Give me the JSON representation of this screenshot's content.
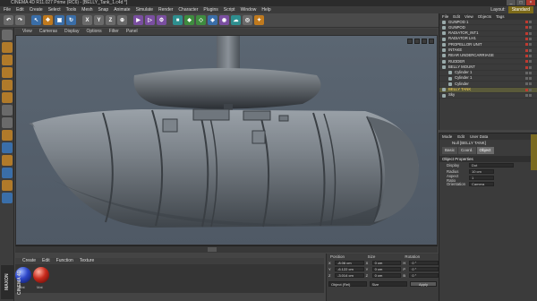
{
  "window": {
    "title": "CINEMA 4D R11.027 Prime (RC6) - [BELLY_Tank_1.c4d *]"
  },
  "menubar": {
    "items": [
      "File",
      "Edit",
      "Create",
      "Select",
      "Tools",
      "Mesh",
      "Snap",
      "Animate",
      "Simulate",
      "Render",
      "Character",
      "Plugins",
      "Script",
      "Window",
      "Help"
    ],
    "layout_label": "Layout:",
    "layout_value": "Standard"
  },
  "viewport": {
    "menu": [
      "View",
      "Cameras",
      "Display",
      "Options",
      "Filter",
      "Panel"
    ]
  },
  "materials": {
    "menu": [
      "Create",
      "Edit",
      "Function",
      "Texture"
    ],
    "items": [
      {
        "name": "Mat",
        "color": "#2c46c8"
      },
      {
        "name": "Mat",
        "color": "#c82a1c"
      }
    ]
  },
  "maxon_logo": "MAXON CINEMA 4D",
  "coordinates": {
    "headers": [
      "Position",
      "Size",
      "Rotation"
    ],
    "rows": [
      {
        "pos_axis": "X",
        "pos": "-8.06 cm",
        "size_axis": "X",
        "size": "0 cm",
        "rot_axis": "H",
        "rot": "0 °"
      },
      {
        "pos_axis": "Y",
        "pos": "-6.122 cm",
        "size_axis": "Y",
        "size": "0 cm",
        "rot_axis": "P",
        "rot": "0 °"
      },
      {
        "pos_axis": "Z",
        "pos": "-3.014 cm",
        "size_axis": "Z",
        "size": "0 cm",
        "rot_axis": "B",
        "rot": "0 °"
      }
    ],
    "mode": "Object (Rel)",
    "size_mode": "Size",
    "apply_label": "Apply"
  },
  "object_manager": {
    "menu": [
      "File",
      "Edit",
      "View",
      "Objects",
      "Tags"
    ],
    "objects": [
      {
        "name": "GUNPOD 1",
        "indent": 0,
        "selected": false
      },
      {
        "name": "GUNPOD",
        "indent": 0,
        "selected": false
      },
      {
        "name": "RADIATOR_INT1",
        "indent": 0,
        "selected": false
      },
      {
        "name": "RADIATOR LH1",
        "indent": 0,
        "selected": false
      },
      {
        "name": "PROPELLOR UNIT",
        "indent": 0,
        "selected": false
      },
      {
        "name": "INTAKE",
        "indent": 0,
        "selected": false
      },
      {
        "name": "REAR UNDERCARRIAGE",
        "indent": 0,
        "selected": false
      },
      {
        "name": "RUDDER",
        "indent": 0,
        "selected": false
      },
      {
        "name": "BELLY MOUNT",
        "indent": 0,
        "selected": false
      },
      {
        "name": "Cylinder 1",
        "indent": 1,
        "selected": false
      },
      {
        "name": "Cylinder 1",
        "indent": 1,
        "selected": false
      },
      {
        "name": "Cylinder",
        "indent": 1,
        "selected": false
      },
      {
        "name": "BELLY TANK",
        "indent": 0,
        "selected": true
      },
      {
        "name": "Sky",
        "indent": 0,
        "selected": false
      }
    ]
  },
  "attribute_manager": {
    "menu": [
      "Mode",
      "Edit",
      "User Data"
    ],
    "title": "Null [BELLY TANK]",
    "tabs": [
      {
        "label": "Basic",
        "active": false
      },
      {
        "label": "Coord.",
        "active": false
      },
      {
        "label": "Object",
        "active": true
      }
    ],
    "section": "Object Properties",
    "fields": [
      {
        "label": "Display",
        "value": "Dot"
      },
      {
        "label": "Radius",
        "value": "10 cm"
      },
      {
        "label": "Aspect Ratio",
        "value": "1"
      },
      {
        "label": "Orientation",
        "value": "Camera"
      }
    ]
  }
}
